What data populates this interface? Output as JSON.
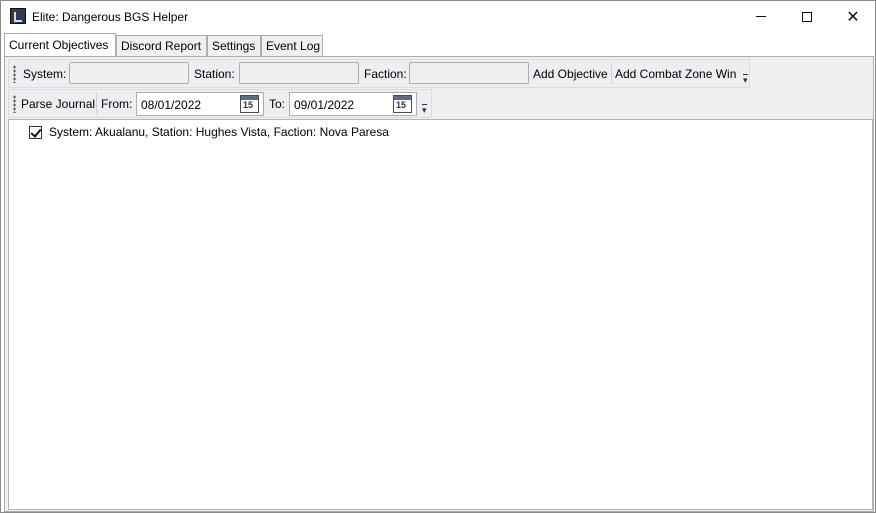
{
  "window": {
    "title": "Elite: Dangerous BGS Helper"
  },
  "tabs": [
    {
      "label": "Current Objectives",
      "active": true
    },
    {
      "label": "Discord Report",
      "active": false
    },
    {
      "label": "Settings",
      "active": false
    },
    {
      "label": "Event Log",
      "active": false
    }
  ],
  "objective_toolbar": {
    "system_label": "System:",
    "system_value": "",
    "station_label": "Station:",
    "station_value": "",
    "faction_label": "Faction:",
    "faction_value": "",
    "add_objective_label": "Add Objective",
    "add_combat_zone_label": "Add Combat Zone Win"
  },
  "journal_toolbar": {
    "parse_journal_label": "Parse Journal",
    "from_label": "From:",
    "from_date": "08/01/2022",
    "to_label": "To:",
    "to_date": "09/01/2022",
    "calendar_icon_text": "15"
  },
  "objectives": [
    {
      "label": "System: Akualanu, Station: Hughes Vista, Faction: Nova Paresa",
      "checked": true
    }
  ],
  "icons": {
    "app": "app-icon",
    "minimize": "minimize-icon",
    "maximize": "maximize-icon",
    "close": "close-icon",
    "calendar": "calendar-icon",
    "checkbox": "checkbox-icon"
  }
}
